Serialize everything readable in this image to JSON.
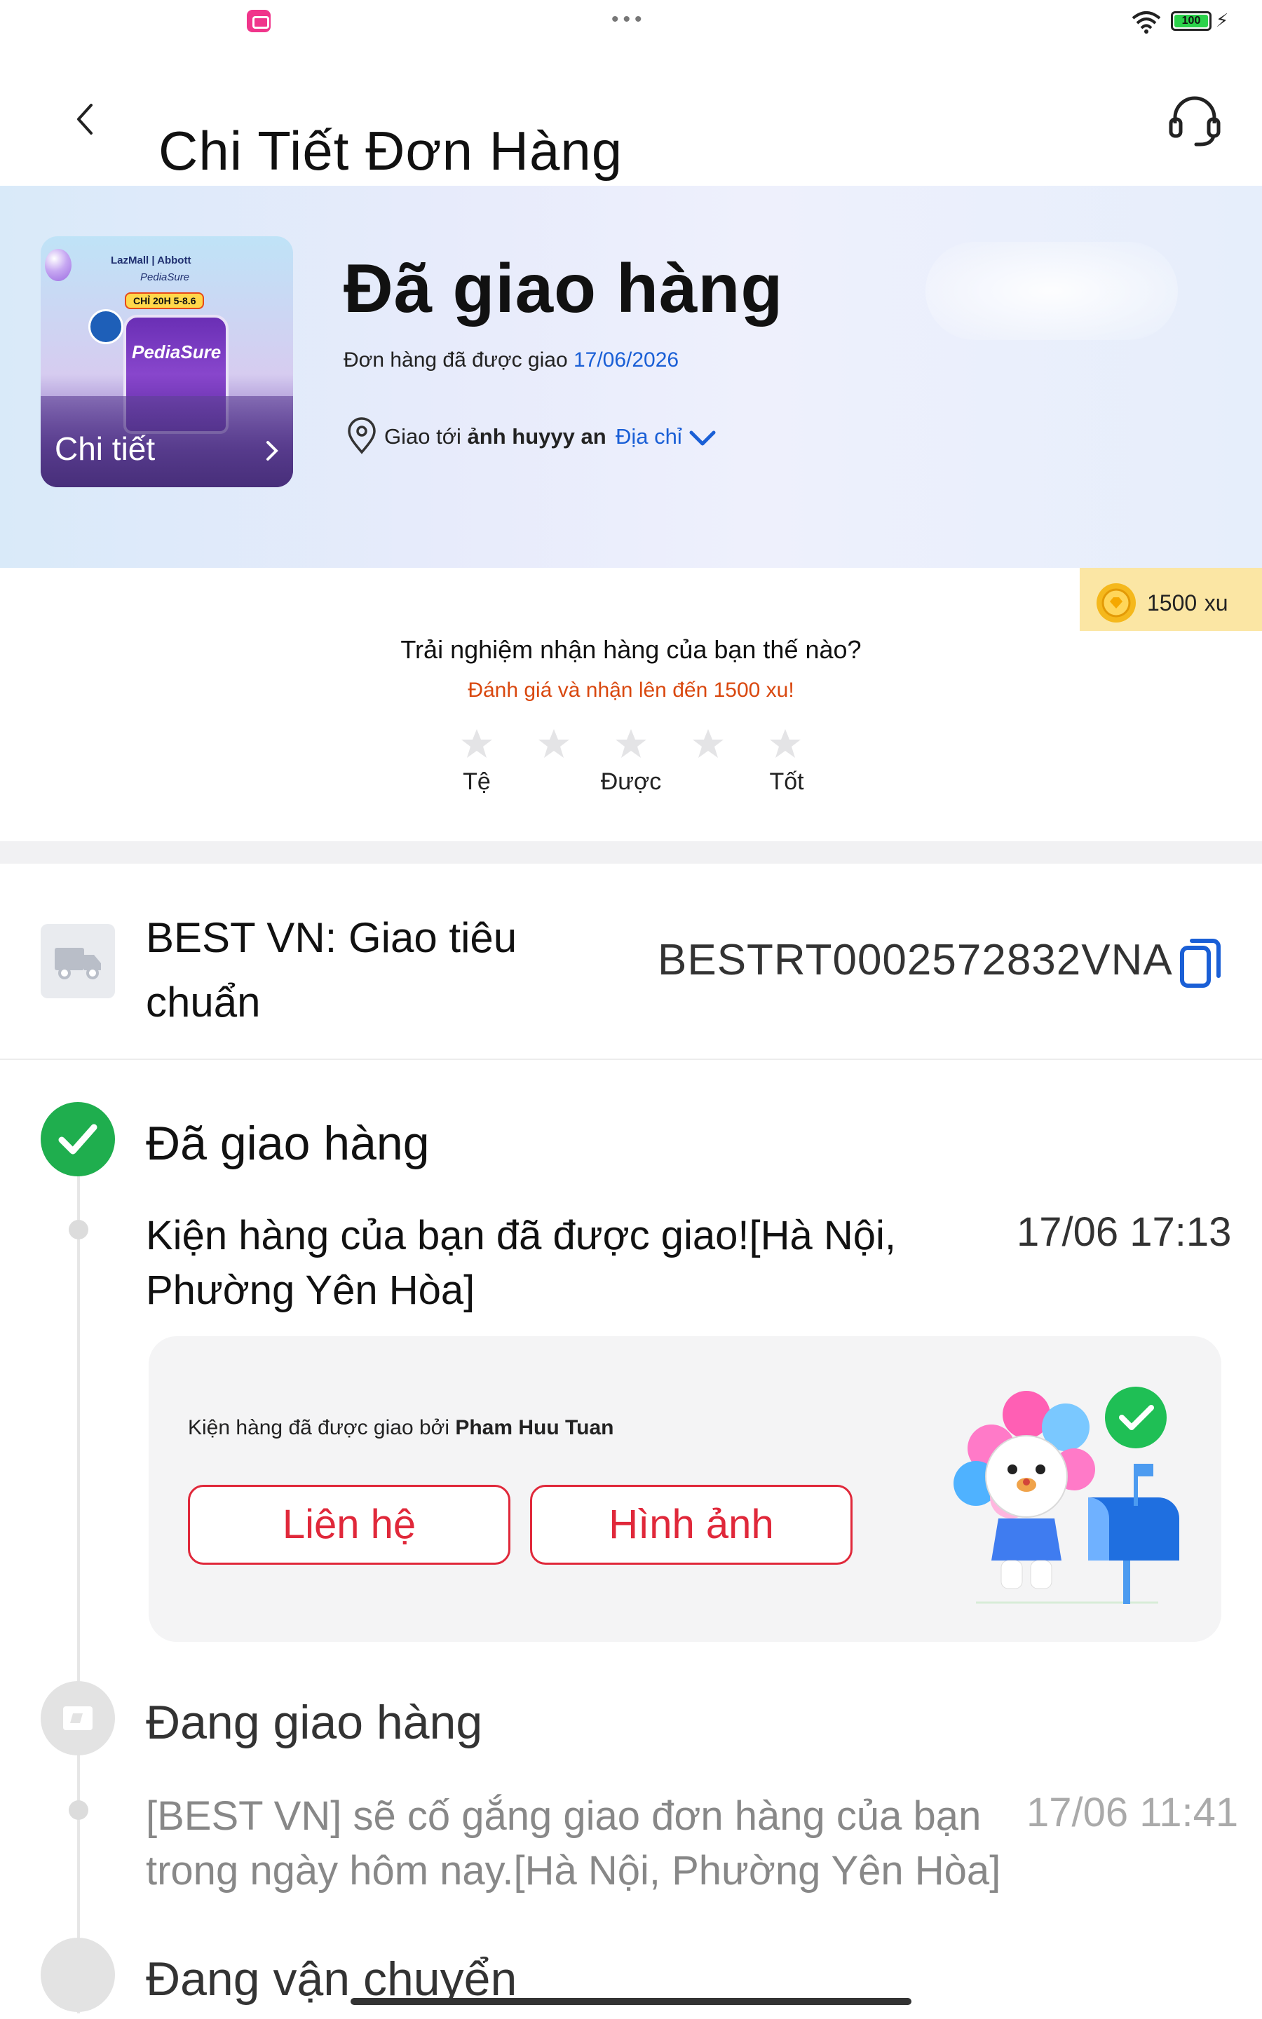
{
  "status_bar": {
    "battery": "100"
  },
  "header": {
    "title": "Chi Tiết Đơn Hàng"
  },
  "hero": {
    "product_brand": "LazMall | Abbott",
    "product_sub": "PediaSure",
    "product_tag": "CHỈ 20H 5-8.6",
    "product_can_label": "PediaSure",
    "detail_label": "Chi tiết",
    "status_title": "Đã giao hàng",
    "status_sub": "Đơn hàng đã được giao ",
    "status_date": "17/06/2026",
    "deliver_prefix": "Giao tới ",
    "deliver_name": "ảnh huyyy an",
    "address_link": "Địa chỉ"
  },
  "rating": {
    "coins_value": "1500",
    "coins_unit": "xu",
    "question": "Trải nghiệm nhận hàng của bạn thế nào?",
    "subtitle": "Đánh giá và nhận lên đến 1500 xu!",
    "labels": {
      "bad": "Tệ",
      "ok": "Được",
      "good": "Tốt"
    }
  },
  "carrier": {
    "name": "BEST VN: Giao tiêu chuẩn",
    "tracking_number": "BESTRT0002572832VNA"
  },
  "timeline": {
    "step1": {
      "title": "Đã giao hàng",
      "text": "Kiện hàng của bạn đã được giao![Hà Nội, Phường Yên Hòa]",
      "time": "17/06 17:13",
      "proof_prefix": "Kiện hàng đã được giao bởi ",
      "courier": "Pham Huu Tuan",
      "contact_button": "Liên hệ",
      "photo_button": "Hình ảnh"
    },
    "step2": {
      "title": "Đang giao hàng",
      "text": "[BEST VN] sẽ cố gắng giao đơn hàng của bạn trong ngày hôm nay.[Hà Nội, Phường Yên Hòa]",
      "time": "17/06 11:41"
    },
    "step3": {
      "title": "Đang vận chuyển"
    }
  },
  "colors": {
    "accent_blue": "#1a5fd6",
    "accent_red": "#e0283a",
    "success_green": "#1fae4e",
    "coin_bg": "#fbe6a4",
    "reward_orange": "#d9480f"
  }
}
